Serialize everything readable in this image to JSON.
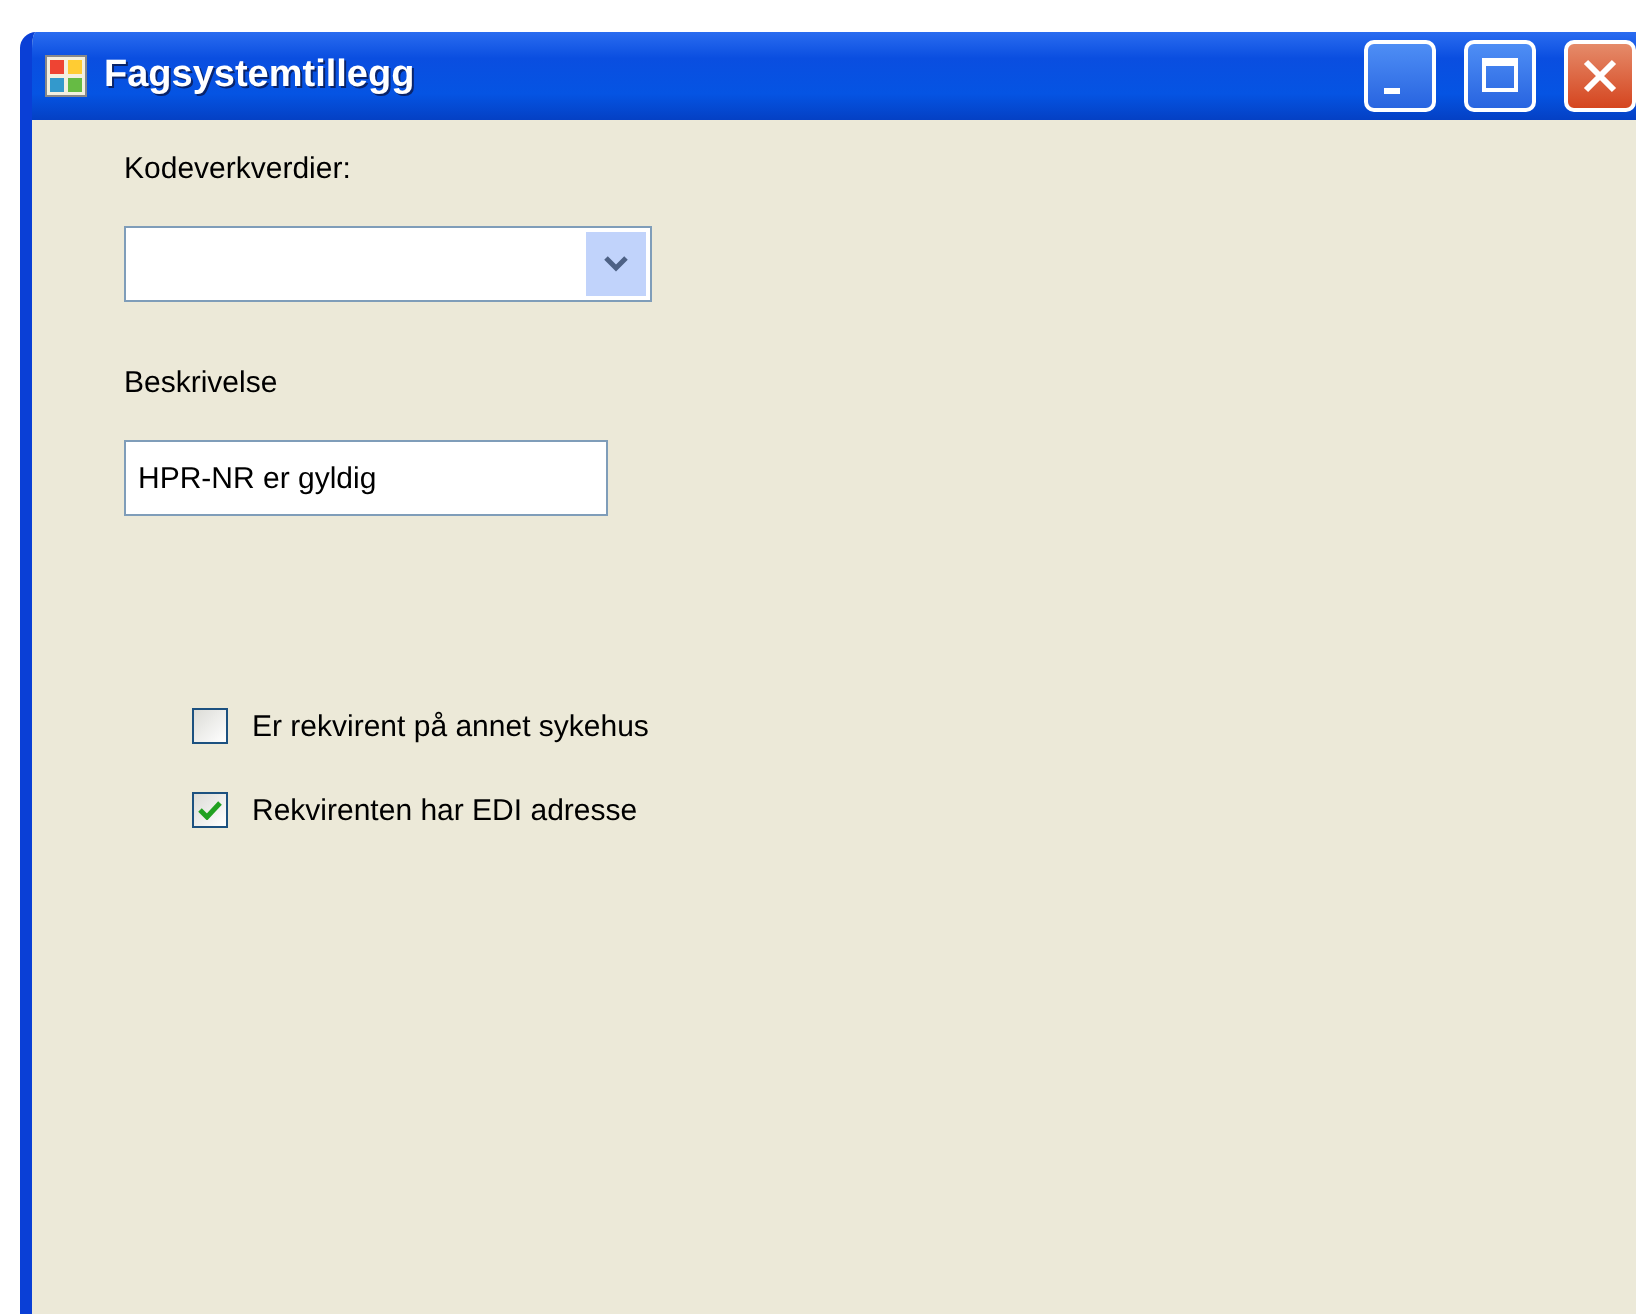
{
  "window": {
    "title": "Fagsystemtillegg"
  },
  "code_field": {
    "label": "Kodeverkverdier:"
  },
  "description": {
    "label": "Beskrivelse",
    "value": "HPR-NR er gyldig"
  },
  "checkboxes": [
    {
      "label": "Er rekvirent på annet sykehus",
      "checked": false
    },
    {
      "label": "Rekvirenten har EDI adresse",
      "checked": true
    }
  ]
}
